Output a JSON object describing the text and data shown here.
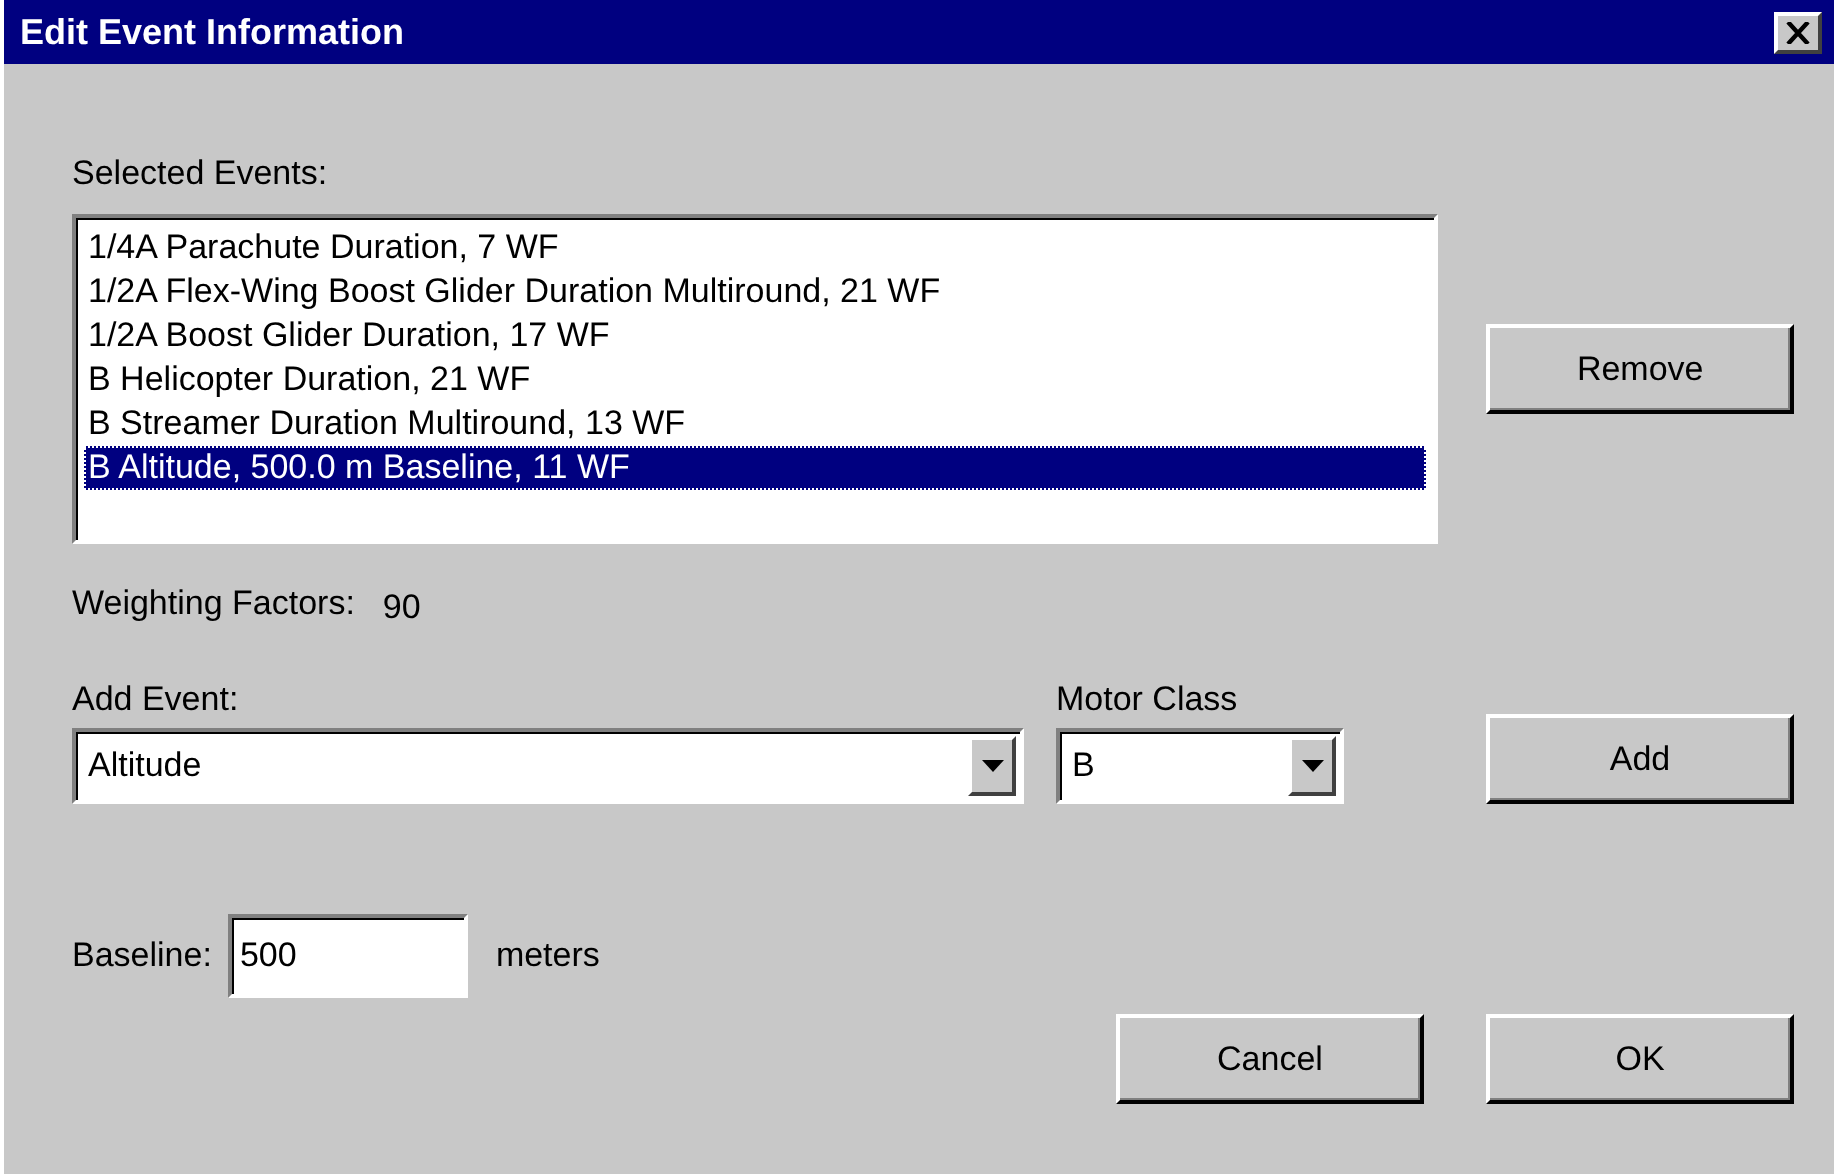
{
  "window": {
    "title": "Edit Event Information"
  },
  "selected_events": {
    "label": "Selected Events:",
    "items": [
      {
        "text": "1/4A Parachute Duration, 7 WF",
        "selected": false
      },
      {
        "text": "1/2A Flex-Wing Boost Glider Duration Multiround, 21 WF",
        "selected": false
      },
      {
        "text": "1/2A Boost Glider Duration, 17 WF",
        "selected": false
      },
      {
        "text": "B Helicopter Duration, 21 WF",
        "selected": false
      },
      {
        "text": "B Streamer Duration Multiround, 13 WF",
        "selected": false
      },
      {
        "text": "B Altitude, 500.0 m Baseline, 11 WF",
        "selected": true
      }
    ]
  },
  "remove_button": "Remove",
  "weighting": {
    "label": "Weighting Factors:",
    "value": "90"
  },
  "add_event": {
    "label": "Add Event:",
    "value": "Altitude"
  },
  "motor_class": {
    "label": "Motor Class",
    "value": "B"
  },
  "add_button": "Add",
  "baseline": {
    "label": "Baseline:",
    "value": "500",
    "unit": "meters"
  },
  "buttons": [
    "Cancel",
    "OK"
  ]
}
